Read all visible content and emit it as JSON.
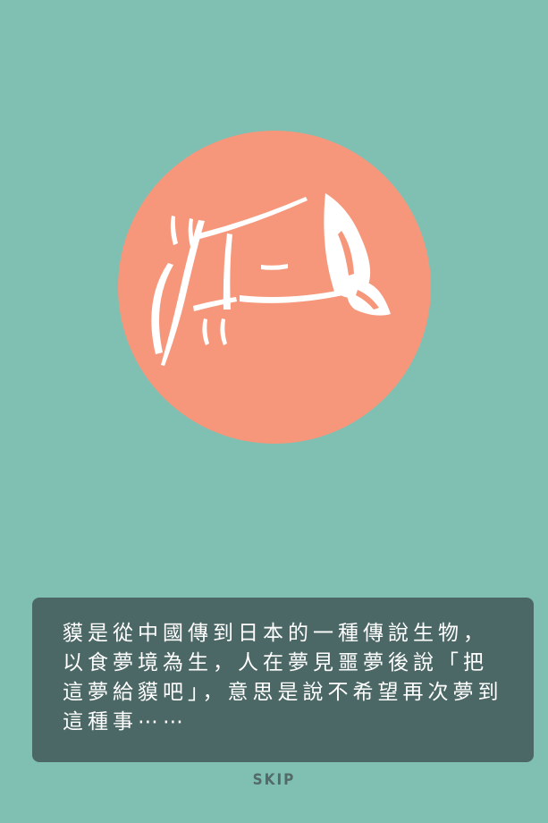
{
  "colors": {
    "background": "#7fc0b3",
    "logo_circle": "#f6977b",
    "card": "#4c6866",
    "text": "#ffffff",
    "skip": "#536a68"
  },
  "logo": {
    "icon": "baku-dream-eater-brush-logo"
  },
  "story": {
    "text": "貘是從中國傳到日本的一種傳說生物，以食夢境為生，人在夢見噩夢後說「把這夢給貘吧」，意思是說不希望再次夢到這種事⋯⋯"
  },
  "skip": {
    "label": "SKIP"
  }
}
